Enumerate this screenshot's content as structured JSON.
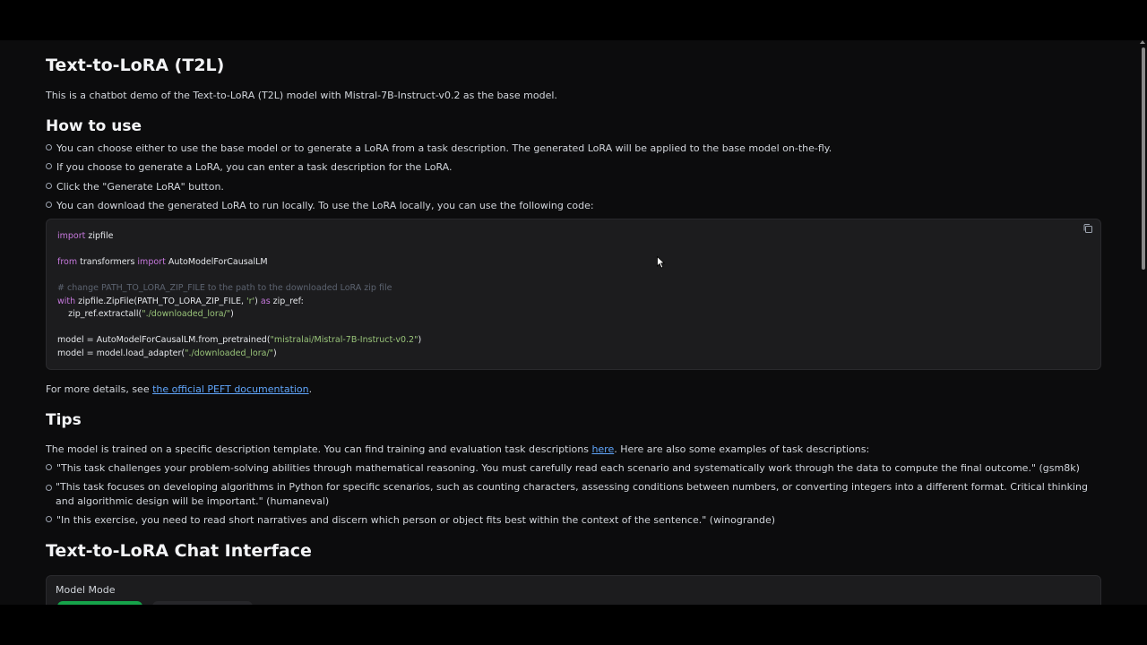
{
  "title": "Text-to-LoRA (T2L)",
  "intro": "This is a chatbot demo of the Text-to-LoRA (T2L) model with Mistral-7B-Instruct-v0.2 as the base model.",
  "how_to_use": {
    "heading": "How to use",
    "items": [
      "You can choose either to use the base model or to generate a LoRA from a task description. The generated LoRA will be applied to the base model on-the-fly.",
      "If you choose to generate a LoRA, you can enter a task description for the LoRA.",
      "Click the \"Generate LoRA\" button.",
      "You can download the generated LoRA to run locally. To use the LoRA locally, you can use the following code:"
    ]
  },
  "code": {
    "import_kw": "import",
    "import_mod": " zipfile",
    "from_kw": "from",
    "from_mod": " transformers ",
    "from_import_kw": "import",
    "from_cls": " AutoModelForCausalLM",
    "comment": "# change PATH_TO_LORA_ZIP_FILE to the path to the downloaded LoRA zip file",
    "with_kw": "with",
    "with_expr": " zipfile.ZipFile(PATH_TO_LORA_ZIP_FILE, ",
    "with_mode": "'r'",
    "with_paren": ") ",
    "as_kw": "as",
    "with_tail": " zip_ref:",
    "extract_pre": "    zip_ref.extractall(",
    "extract_str": "\"./downloaded_lora/\"",
    "extract_post": ")",
    "model_pre": "model = AutoModelForCausalLM.from_pretrained(",
    "model_str": "\"mistralai/Mistral-7B-Instruct-v0.2\"",
    "model_post": ")",
    "adapter_pre": "model = model.load_adapter(",
    "adapter_str": "\"./downloaded_lora/\"",
    "adapter_post": ")"
  },
  "details": {
    "prefix": "For more details, see ",
    "link": "the official PEFT documentation",
    "suffix": "."
  },
  "tips": {
    "heading": "Tips",
    "intro_prefix": "The model is trained on a specific description template. You can find training and evaluation task descriptions ",
    "intro_link": "here",
    "intro_suffix": ". Here are also some examples of task descriptions:",
    "items": [
      "\"This task challenges your problem-solving abilities through mathematical reasoning. You must carefully read each scenario and systematically work through the data to compute the final outcome.\" (gsm8k)",
      "\"This task focuses on developing algorithms in Python for specific scenarios, such as counting characters, assessing conditions between numbers, or converting integers into a different format. Critical thinking and algorithmic design will be important.\" (humaneval)",
      "\"In this exercise, you need to read short narratives and discern which person or object fits best within the context of the sentence.\" (winogrande)"
    ]
  },
  "chat": {
    "heading": "Text-to-LoRA Chat Interface",
    "model_mode_label": "Model Mode"
  },
  "colors": {
    "accent_green": "#16a34a",
    "link_blue": "#60a5fa",
    "background": "#0c0c0d"
  },
  "icons": [
    "copy-icon",
    "mouse-cursor-icon",
    "scroll-up-icon"
  ]
}
